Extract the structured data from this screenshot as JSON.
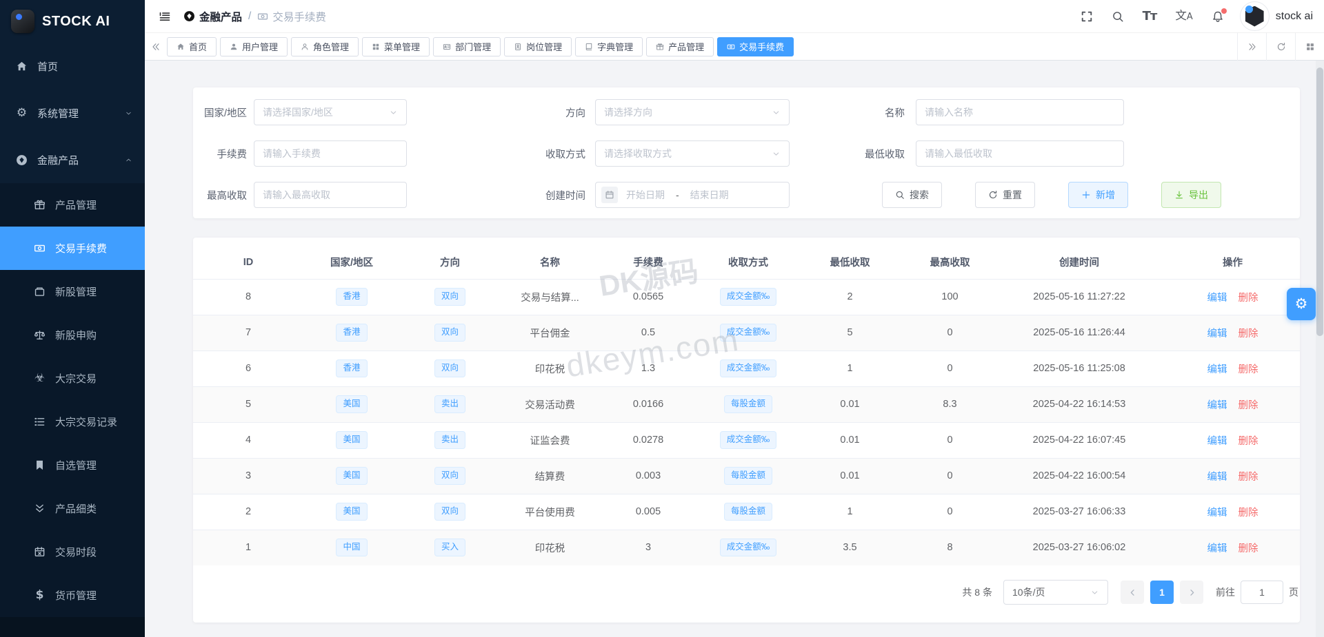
{
  "app": {
    "logo_text": "STOCK AI",
    "username": "stock ai"
  },
  "colors": {
    "accent": "#409eff",
    "danger": "#f56c6c",
    "success": "#67c23a",
    "sidebar-bg": "#0c1e32"
  },
  "sidebar": {
    "items": [
      {
        "name": "home",
        "label": "首页",
        "icon": "home-icon"
      },
      {
        "name": "system-management",
        "label": "系统管理",
        "icon": "gear-icon",
        "chevron": "down"
      },
      {
        "name": "financial-products",
        "label": "金融产品",
        "icon": "diamond-circle-icon",
        "chevron": "up",
        "children": [
          {
            "name": "product-management",
            "label": "产品管理",
            "icon": "gift-icon"
          },
          {
            "name": "transaction-fee",
            "label": "交易手续费",
            "icon": "money-icon",
            "active": true
          },
          {
            "name": "new-stock-management",
            "label": "新股管理",
            "icon": "archive-icon"
          },
          {
            "name": "new-stock-subscription",
            "label": "新股申购",
            "icon": "scales-icon"
          },
          {
            "name": "block-trade",
            "label": "大宗交易",
            "icon": "biohazard-icon"
          },
          {
            "name": "block-trade-records",
            "label": "大宗交易记录",
            "icon": "list-icon"
          },
          {
            "name": "watchlist-management",
            "label": "自选管理",
            "icon": "bookmark-icon"
          },
          {
            "name": "product-subcategory",
            "label": "产品细类",
            "icon": "double-chevron-down-icon"
          },
          {
            "name": "trading-session",
            "label": "交易时段",
            "icon": "calendar-icon"
          },
          {
            "name": "currency-management",
            "label": "货币管理",
            "icon": "dollar-icon"
          }
        ]
      }
    ]
  },
  "header": {
    "breadcrumb": {
      "parent": "金融产品",
      "separator": "/",
      "current": "交易手续费"
    }
  },
  "tabbar": {
    "tabs": [
      {
        "name": "home",
        "label": "首页",
        "icon": "home-icon"
      },
      {
        "name": "user-management",
        "label": "用户管理",
        "icon": "user-icon"
      },
      {
        "name": "role-management",
        "label": "角色管理",
        "icon": "user-outline-icon"
      },
      {
        "name": "menu-management",
        "label": "菜单管理",
        "icon": "grid-icon"
      },
      {
        "name": "department-management",
        "label": "部门管理",
        "icon": "idcard-icon"
      },
      {
        "name": "position-management",
        "label": "岗位管理",
        "icon": "badge-icon"
      },
      {
        "name": "dictionary-management",
        "label": "字典管理",
        "icon": "book-icon"
      },
      {
        "name": "product-management",
        "label": "产品管理",
        "icon": "gift-icon"
      },
      {
        "name": "transaction-fee",
        "label": "交易手续费",
        "icon": "money-icon",
        "active": true
      }
    ]
  },
  "filters": {
    "fields": [
      {
        "name": "country",
        "label": "国家/地区",
        "control": "select",
        "placeholder": "请选择国家/地区",
        "row": 1,
        "col": 1
      },
      {
        "name": "direction",
        "label": "方向",
        "control": "select",
        "placeholder": "请选择方向",
        "row": 1,
        "col": 2
      },
      {
        "name": "name",
        "label": "名称",
        "control": "input",
        "placeholder": "请输入名称",
        "row": 1,
        "col": 3
      },
      {
        "name": "fee",
        "label": "手续费",
        "control": "input",
        "placeholder": "请输入手续费",
        "row": 2,
        "col": 1
      },
      {
        "name": "charge-method",
        "label": "收取方式",
        "control": "select",
        "placeholder": "请选择收取方式",
        "row": 2,
        "col": 2
      },
      {
        "name": "min-charge",
        "label": "最低收取",
        "control": "input",
        "placeholder": "请输入最低收取",
        "row": 2,
        "col": 3
      },
      {
        "name": "max-charge",
        "label": "最高收取",
        "control": "input",
        "placeholder": "请输入最高收取",
        "row": 3,
        "col": 1
      },
      {
        "name": "created-time",
        "label": "创建时间",
        "control": "daterange",
        "start_placeholder": "开始日期",
        "separator": "-",
        "end_placeholder": "结束日期",
        "row": 3,
        "col": 2
      }
    ],
    "buttons": [
      {
        "name": "search",
        "label": "搜索",
        "icon": "search-icon",
        "style": "default"
      },
      {
        "name": "reset",
        "label": "重置",
        "icon": "refresh-icon",
        "style": "default"
      },
      {
        "name": "add",
        "label": "新增",
        "icon": "plus-icon",
        "style": "primary-plain"
      },
      {
        "name": "export",
        "label": "导出",
        "icon": "download-icon",
        "style": "success-plain"
      }
    ]
  },
  "table": {
    "columns": [
      "ID",
      "国家/地区",
      "方向",
      "名称",
      "手续费",
      "收取方式",
      "最低收取",
      "最高收取",
      "创建时间",
      "操作"
    ],
    "rows": [
      {
        "id": "8",
        "region": "香港",
        "direction": "双向",
        "name": "交易与结算...",
        "fee": "0.0565",
        "method": "成交金额‰",
        "min": "2",
        "max": "100",
        "created": "2025-05-16 11:27:22"
      },
      {
        "id": "7",
        "region": "香港",
        "direction": "双向",
        "name": "平台佣金",
        "fee": "0.5",
        "method": "成交金额‰",
        "min": "5",
        "max": "0",
        "created": "2025-05-16 11:26:44"
      },
      {
        "id": "6",
        "region": "香港",
        "direction": "双向",
        "name": "印花税",
        "fee": "1.3",
        "method": "成交金额‰",
        "min": "1",
        "max": "0",
        "created": "2025-05-16 11:25:08"
      },
      {
        "id": "5",
        "region": "美国",
        "direction": "卖出",
        "name": "交易活动费",
        "fee": "0.0166",
        "method": "每股金额",
        "min": "0.01",
        "max": "8.3",
        "created": "2025-04-22 16:14:53"
      },
      {
        "id": "4",
        "region": "美国",
        "direction": "卖出",
        "name": "证监会费",
        "fee": "0.0278",
        "method": "成交金额‰",
        "min": "0.01",
        "max": "0",
        "created": "2025-04-22 16:07:45"
      },
      {
        "id": "3",
        "region": "美国",
        "direction": "双向",
        "name": "结算费",
        "fee": "0.003",
        "method": "每股金额",
        "min": "0.01",
        "max": "0",
        "created": "2025-04-22 16:00:54"
      },
      {
        "id": "2",
        "region": "美国",
        "direction": "双向",
        "name": "平台使用费",
        "fee": "0.005",
        "method": "每股金额",
        "min": "1",
        "max": "0",
        "created": "2025-03-27 16:06:33"
      },
      {
        "id": "1",
        "region": "中国",
        "direction": "买入",
        "name": "印花税",
        "fee": "3",
        "method": "成交金额‰",
        "min": "3.5",
        "max": "8",
        "created": "2025-03-27 16:06:02"
      }
    ],
    "actions": {
      "edit": "编辑",
      "delete": "删除"
    },
    "watermarks": [
      "DK源码",
      "dkeym.com"
    ]
  },
  "pagination": {
    "total_text": "共 8 条",
    "page_size": "10条/页",
    "current_page": "1",
    "goto_label": "前往",
    "goto_value": "1",
    "unit_label": "页"
  }
}
